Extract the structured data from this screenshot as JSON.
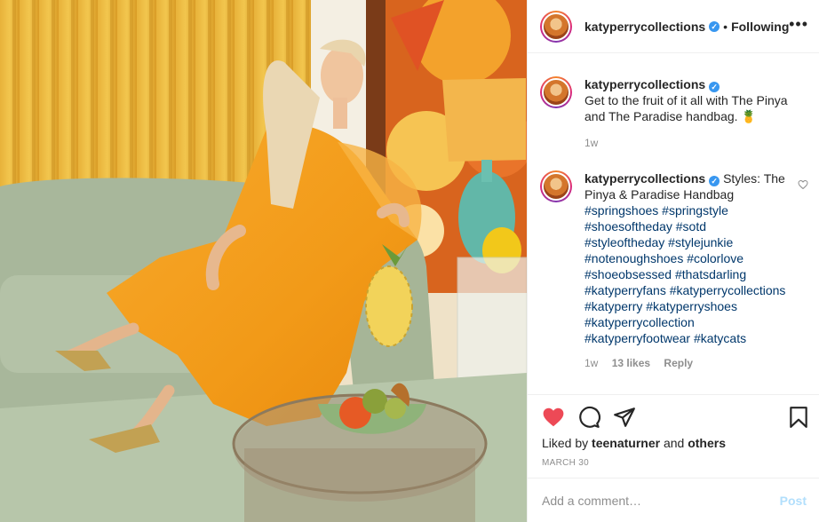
{
  "post": {
    "username": "katyperrycollections",
    "verified_mark": "✓",
    "separator": "•",
    "follow_status": "Following",
    "more_icon": "•••"
  },
  "caption": {
    "username": "katyperrycollections",
    "text": "Get to the fruit of it all with The Pinya and The Paradise handbag. 🍍",
    "age": "1w"
  },
  "comment": {
    "username": "katyperrycollections",
    "text_prefix": "Styles: The Pinya & Paradise Handbag",
    "hashtag_lines": [
      "#springshoes #springstyle",
      "#shoesoftheday #sotd",
      "#styleoftheday #stylejunkie",
      "#notenoughshoes #colorlove",
      "#shoeobsessed #thatsdarling",
      "#katyperryfans #katyperrycollections",
      "#katyperry #katyperryshoes",
      "#katyperrycollection",
      "#katyperryfootwear #katycats"
    ],
    "age": "1w",
    "likes": "13 likes",
    "reply": "Reply"
  },
  "engagement": {
    "liked_by_prefix": "Liked by",
    "liked_by_user": "teenaturner",
    "and_word": "and",
    "others": "others",
    "date": "MARCH 30"
  },
  "add_comment": {
    "placeholder": "Add a comment…",
    "post_label": "Post"
  },
  "colors": {
    "accent_blue": "#3897f0",
    "heart_red": "#ed4956",
    "hashtag": "#00376b",
    "muted": "#8e8e8e",
    "post_disabled": "#b2dffc"
  },
  "icons": [
    "heart-filled-icon",
    "comment-icon",
    "share-icon",
    "bookmark-icon",
    "heart-outline-icon",
    "verified-badge-icon",
    "more-options-icon"
  ]
}
